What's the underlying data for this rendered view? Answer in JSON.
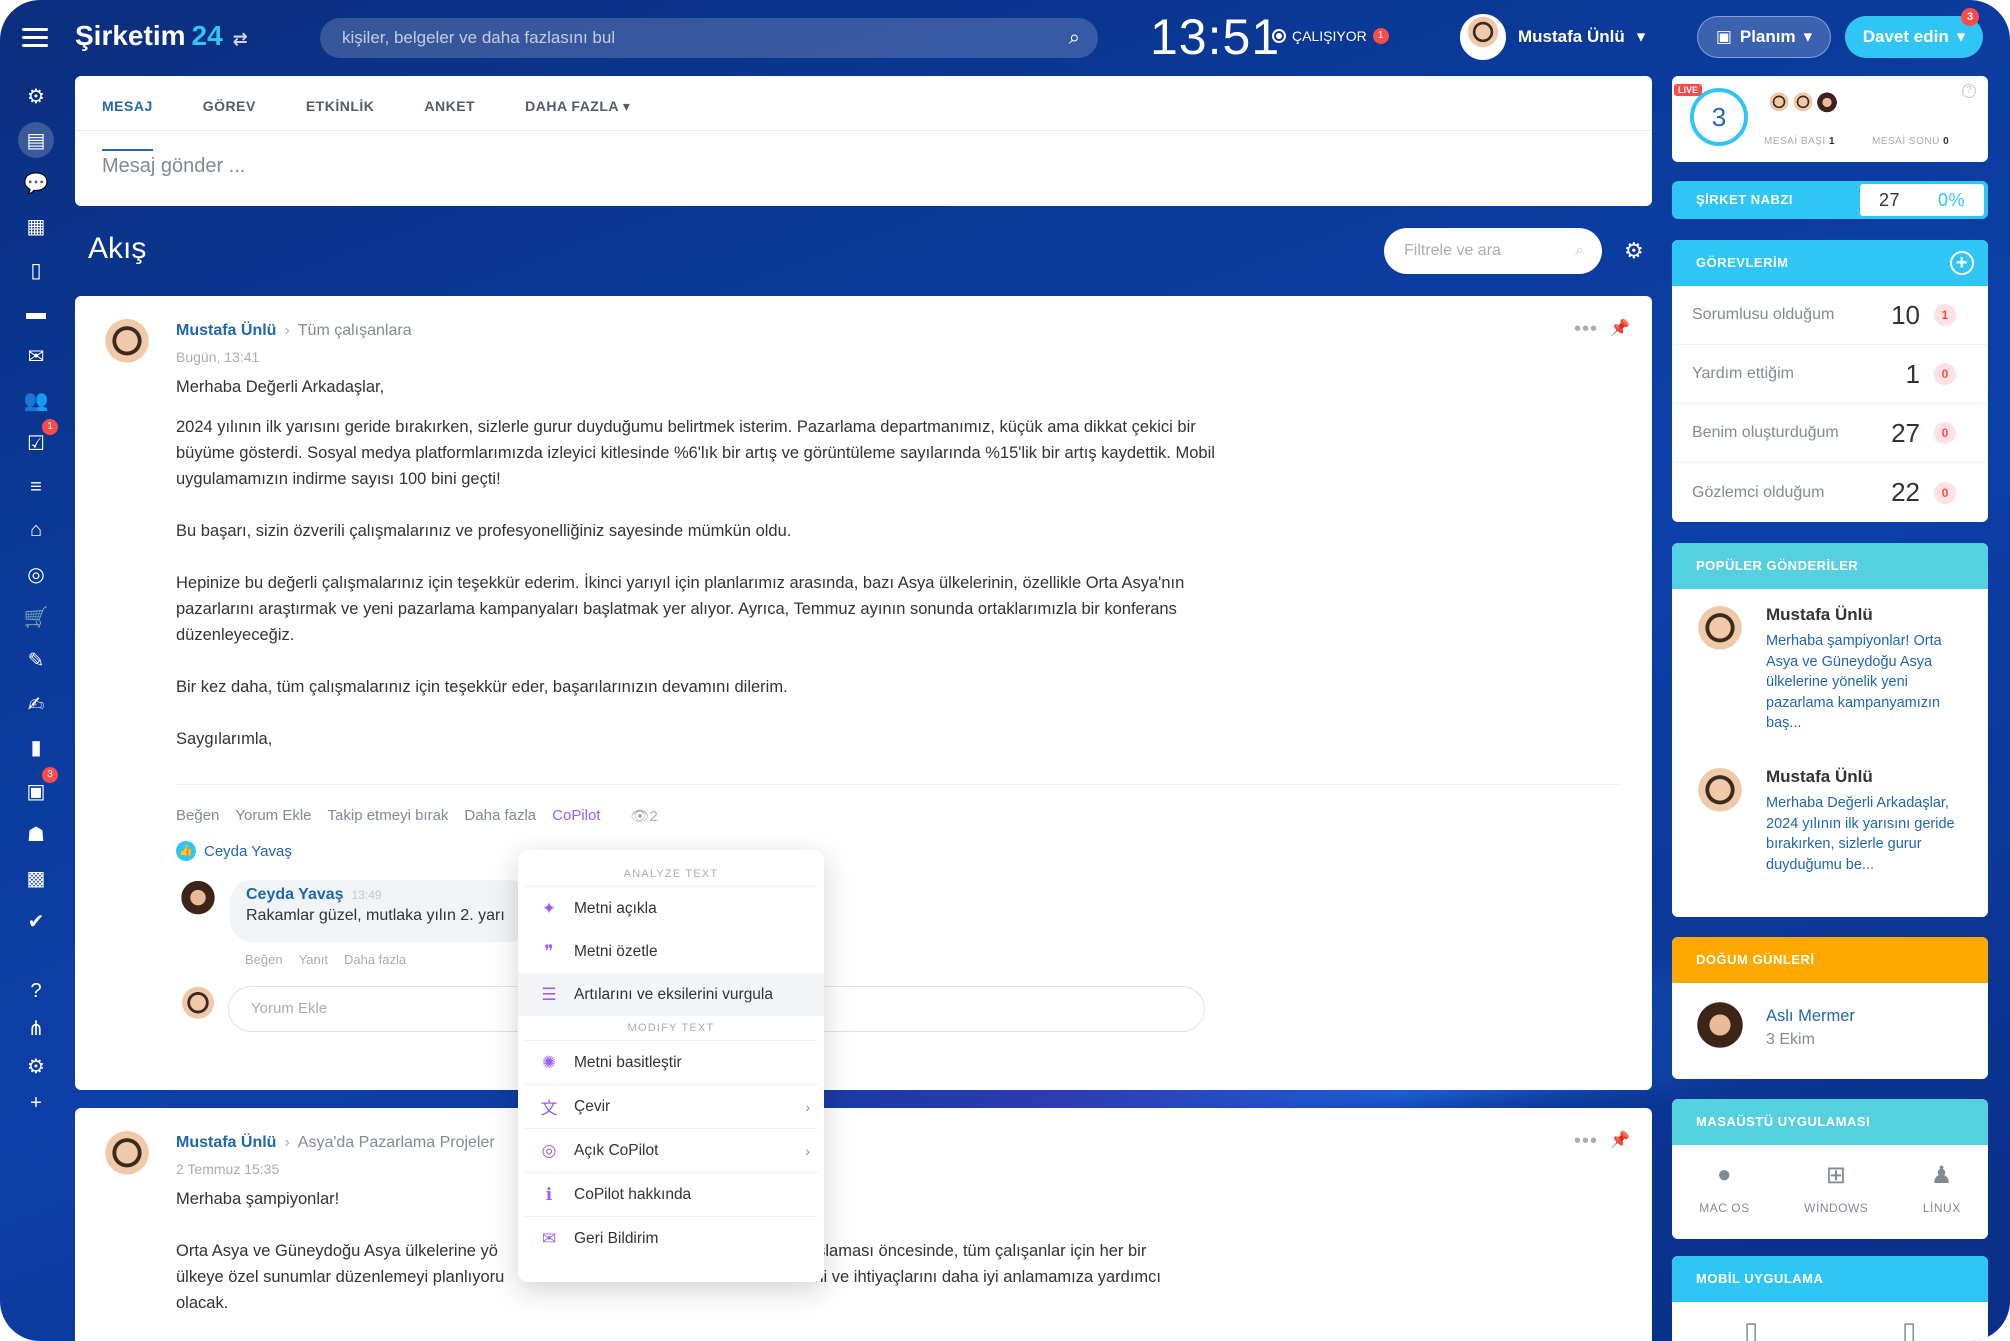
{
  "header": {
    "logo": "Şirketim",
    "logo_num": "24",
    "search_placeholder": "kişiler, belgeler ve daha fazlasını bul",
    "clock": "13:51",
    "status": "ÇALIŞIYOR",
    "status_badge": "1",
    "user_name": "Mustafa Ünlü",
    "plan_label": "Planım",
    "invite_label": "Davet edin",
    "invite_badge": "3"
  },
  "sidebar": {
    "badges": {
      "tasks": "1",
      "contacts": "3"
    }
  },
  "composer": {
    "tabs": [
      "MESAJ",
      "GÖREV",
      "ETKİNLİK",
      "ANKET",
      "DAHA FAZLA"
    ],
    "placeholder": "Mesaj gönder ..."
  },
  "feed": {
    "title": "Akış",
    "filter_placeholder": "Filtrele ve ara"
  },
  "post1": {
    "author": "Mustafa Ünlü",
    "destination": "Tüm çalışanlara",
    "date": "Bugün, 13:41",
    "greeting": "Merhaba Değerli Arkadaşlar,",
    "p1": "2024 yılının ilk yarısını geride bırakırken, sizlerle gurur duyduğumu belirtmek isterim. Pazarlama departmanımız, küçük ama dikkat çekici bir büyüme gösterdi. Sosyal medya platformlarımızda izleyici kitlesinde %6'lık bir artış ve görüntüleme sayılarında %15'lik bir artış kaydettik. Mobil uygulamamızın indirme sayısı 100 bini geçti!",
    "p2": "Bu başarı, sizin özverili çalışmalarınız ve profesyonelliğiniz sayesinde mümkün oldu.",
    "p3": "Hepinize bu değerli çalışmalarınız için teşekkür ederim. İkinci yarıyıl için planlarımız arasında, bazı Asya ülkelerinin, özellikle Orta Asya'nın pazarlarını araştırmak ve yeni pazarlama kampanyaları başlatmak yer alıyor. Ayrıca, Temmuz ayının sonunda ortaklarımızla bir konferans düzenleyeceğiz.",
    "p4": "Bir kez daha, tüm çalışmalarınız için teşekkür eder, başarılarınızın devamını dilerim.",
    "closing": "Saygılarımla,",
    "actions": {
      "like": "Beğen",
      "comment": "Yorum Ekle",
      "unfollow": "Takip etmeyi bırak",
      "more": "Daha fazla",
      "copilot": "CoPilot",
      "views": "2"
    },
    "liker": "Ceyda Yavaş",
    "comment": {
      "author": "Ceyda Yavaş",
      "time": "13:49",
      "text": "Rakamlar güzel, mutlaka yılın 2. yarı",
      "like": "Beğen",
      "reply": "Yanıt",
      "more": "Daha fazla"
    },
    "add_comment_placeholder": "Yorum Ekle"
  },
  "post2": {
    "author": "Mustafa Ünlü",
    "destination": "Asya'da Pazarlama Projeler",
    "date": "2 Temmuz 15:35",
    "greeting": "Merhaba şampiyonlar!",
    "p1_start": "Orta Asya ve Güneydoğu Asya ülkelerine yö",
    "p1_end": "aşlaması öncesinde, tüm çalışanlar için her bir",
    "p2_start": "ülkeye özel sunumlar düzenlemeyi planlıyoru",
    "p2_end": "ni ve ihtiyaçlarını daha iyi anlamamıza yardımcı",
    "p3": "olacak."
  },
  "copilot_menu": {
    "section1": "ANALYZE TEXT",
    "section2": "MODIFY TEXT",
    "items": [
      {
        "label": "Metni açıkla",
        "icon": "sparkle-cursor-icon"
      },
      {
        "label": "Metni özetle",
        "icon": "quote-icon"
      },
      {
        "label": "Artılarını ve eksilerini vurgula",
        "icon": "sliders-icon"
      },
      {
        "label": "Metni basitleştir",
        "icon": "sparkle-icon"
      },
      {
        "label": "Çevir",
        "icon": "translate-icon"
      },
      {
        "label": "Açık CoPilot",
        "icon": "copilot-icon"
      },
      {
        "label": "CoPilot hakkında",
        "icon": "info-icon"
      },
      {
        "label": "Geri Bildirim",
        "icon": "feedback-icon"
      }
    ]
  },
  "right": {
    "live": {
      "tag": "LIVE",
      "count": "3",
      "start_label": "MESAİ BAŞI",
      "start_val": "1",
      "end_label": "MESAİ SONU",
      "end_val": "0"
    },
    "pulse": {
      "label": "ŞİRKET NABZI",
      "value": "27",
      "percent": "0%"
    },
    "tasks": {
      "title": "GÖREVLERİM",
      "rows": [
        {
          "label": "Sorumlusu olduğum",
          "count": "10",
          "badge": "1"
        },
        {
          "label": "Yardım ettiğim",
          "count": "1",
          "badge": "0"
        },
        {
          "label": "Benim oluşturduğum",
          "count": "27",
          "badge": "0"
        },
        {
          "label": "Gözlemci olduğum",
          "count": "22",
          "badge": "0"
        }
      ]
    },
    "popular": {
      "title": "POPÜLER GÖNDERİLER",
      "items": [
        {
          "name": "Mustafa Ünlü",
          "text": "Merhaba şampiyonlar! Orta Asya ve Güneydoğu Asya ülkelerine yönelik yeni pazarlama kampanyamızın baş..."
        },
        {
          "name": "Mustafa Ünlü",
          "text": "Merhaba Değerli Arkadaşlar, 2024 yılının ilk yarısını geride bırakırken, sizlerle gurur duyduğumu be..."
        }
      ]
    },
    "birthdays": {
      "title": "DOĞUM GÜNLERİ",
      "name": "Aslı Mermer",
      "date": "3 Ekim"
    },
    "desktop": {
      "title": "MASAÜSTÜ UYGULAMASI",
      "mac": "MAC OS",
      "windows": "WİNDOWS",
      "linux": "LİNUX"
    },
    "mobile": {
      "title": "MOBİL UYGULAMA"
    }
  },
  "colors": {
    "brand_blue": "#2067b0",
    "accent_cyan": "#2fc6f6",
    "copilot_purple": "#9d5df0",
    "birthday_orange": "#ffa900",
    "badge_red": "#ff4a4a"
  }
}
